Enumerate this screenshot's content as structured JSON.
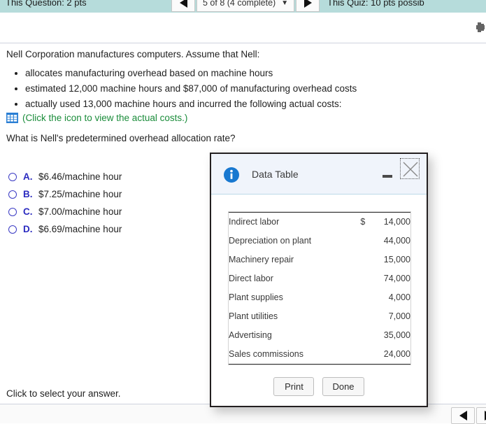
{
  "topbar": {
    "question_points": "This Question: 2 pts",
    "quiz_points": "This Quiz: 10 pts possib",
    "nav": {
      "prev_label": "",
      "position": "5 of 8 (4 complete)",
      "caret": "▼",
      "next_label": ""
    }
  },
  "question": {
    "intro": "Nell Corporation manufactures computers. Assume that Nell:",
    "bullets": [
      "allocates manufacturing overhead based on machine hours",
      "estimated 12,000 machine hours and $87,000 of manufacturing overhead costs",
      "actually used 13,000 machine hours and incurred the following actual costs:"
    ],
    "icon_note": "(Click the icon to view the actual costs.)",
    "prompt": "What is Nell's predetermined overhead allocation rate?",
    "choices": [
      {
        "letter": "A.",
        "text": "$6.46/machine hour"
      },
      {
        "letter": "B.",
        "text": "$7.25/machine hour"
      },
      {
        "letter": "C.",
        "text": "$7.00/machine hour"
      },
      {
        "letter": "D.",
        "text": "$6.69/machine hour"
      }
    ],
    "hint": "Click to select your answer."
  },
  "dialog": {
    "title": "Data Table",
    "minimize_label": "",
    "close_label": "",
    "rows": [
      {
        "label": "Indirect labor",
        "currency": "$",
        "value": "14,000"
      },
      {
        "label": "Depreciation on plant",
        "currency": "",
        "value": "44,000"
      },
      {
        "label": "Machinery repair",
        "currency": "",
        "value": "15,000"
      },
      {
        "label": "Direct labor",
        "currency": "",
        "value": "74,000"
      },
      {
        "label": "Plant supplies",
        "currency": "",
        "value": "4,000"
      },
      {
        "label": "Plant utilities",
        "currency": "",
        "value": "7,000"
      },
      {
        "label": "Advertising",
        "currency": "",
        "value": "35,000"
      },
      {
        "label": "Sales commissions",
        "currency": "",
        "value": "24,000"
      }
    ],
    "print_label": "Print",
    "done_label": "Done"
  },
  "colors": {
    "topbar_bg": "#b6dcdb",
    "link_green": "#1a8c3a",
    "choice_blue": "#2b2bc0",
    "info_blue": "#1878d0"
  }
}
